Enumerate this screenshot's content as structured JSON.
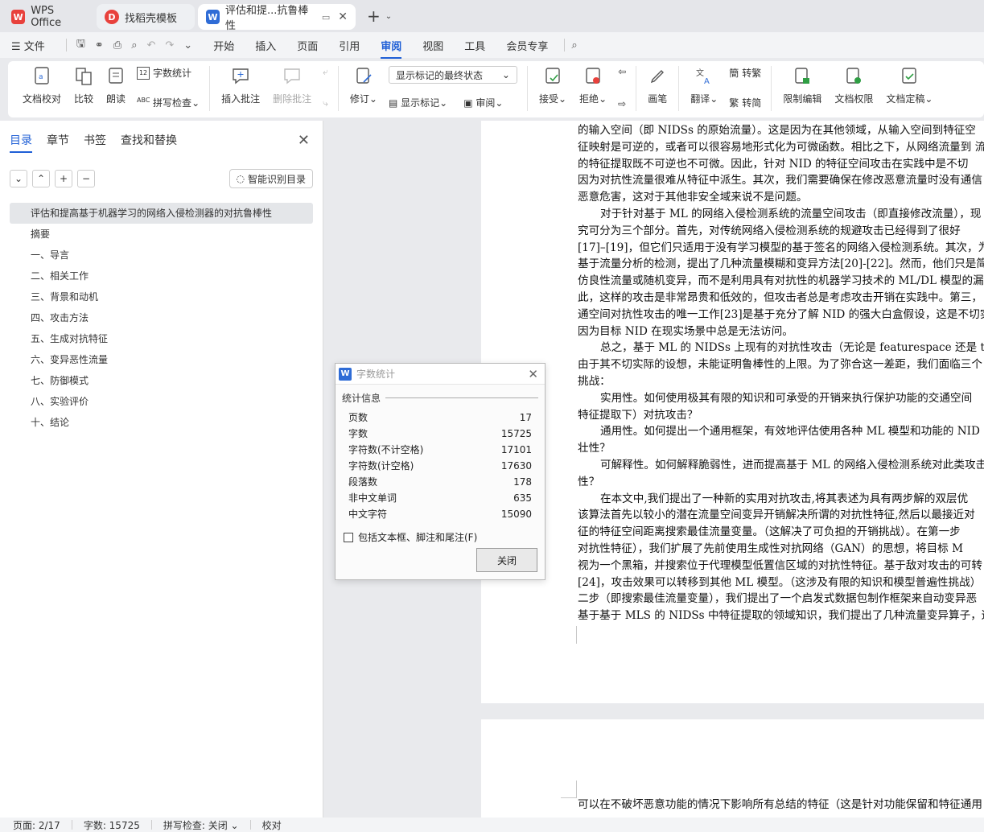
{
  "titlebar": {
    "tabs": [
      {
        "label": "WPS Office",
        "icon": "wps-logo-icon"
      },
      {
        "label": "找稻壳模板",
        "icon": "docer-icon"
      },
      {
        "label": "评估和提...抗鲁棒性",
        "icon": "word-doc-icon"
      }
    ]
  },
  "menubar": {
    "file": "文件",
    "items": [
      "开始",
      "插入",
      "页面",
      "引用",
      "审阅",
      "视图",
      "工具",
      "会员专享"
    ],
    "active": "审阅"
  },
  "ribbon": {
    "doc_check": "文档校对",
    "compare": "比较",
    "read_aloud": "朗读",
    "word_count": "字数统计",
    "spell_check": "拼写检查",
    "insert_comment": "插入批注",
    "delete_comment": "删除批注",
    "revise": "修订",
    "markup_state": "显示标记的最终状态",
    "show_markup": "显示标记",
    "review": "审阅",
    "accept": "接受",
    "reject": "拒绝",
    "pen": "画笔",
    "translate": "翻译",
    "to_traditional": "转繁",
    "to_simplified": "转简",
    "restrict_edit": "限制编辑",
    "doc_permission": "文档权限",
    "doc_finalize": "文档定稿"
  },
  "leftpanel": {
    "tabs": [
      "目录",
      "章节",
      "书签",
      "查找和替换"
    ],
    "smart_toc": "智能识别目录",
    "toc": [
      "评估和提高基于机器学习的网络入侵检测器的对抗鲁棒性",
      "摘要",
      "一、导言",
      "二、相关工作",
      "三、背景和动机",
      "四、攻击方法",
      "五、生成对抗特征",
      "六、变异恶性流量",
      "七、防御模式",
      "八、实验评价",
      "十、结论"
    ]
  },
  "document": {
    "page1_lines": [
      "的输入空间（即 NIDSs 的原始流量）。这是因为在其他领域，从输入空间到特征空",
      "征映射是可逆的，或者可以很容易地形式化为可微函数。相比之下，从网络流量到 流",
      "的特征提取既不可逆也不可微。因此，针对 NID 的特征空间攻击在实践中是不切",
      "因为对抗性流量很难从特征中派生。其次，我们需要确保在修改恶意流量时没有通信",
      "恶意危害，这对于其他非安全域来说不是问题。",
      "对于针对基于 ML 的网络入侵检测系统的流量空间攻击（即直接修改流量），现",
      "究可分为三个部分。首先，对传统网络入侵检测系统的规避攻击已经得到了很好",
      "[17]–[19]，但它们只适用于没有学习模型的基于签名的网络入侵检测系统。其次，为",
      "基于流量分析的检测，提出了几种流量模糊和变异方法[20]-[22]。然而，他们只是简",
      "仿良性流量或随机变异，而不是利用具有对抗性的机器学习技术的 ML/DL 模型的漏",
      "此，这样的攻击是非常昂贵和低效的，但攻击者总是考虑攻击开销在实践中。第三，",
      "通空间对抗性攻击的唯一工作[23]是基于充分了解 NID 的强大白盒假设，这是不切实",
      "因为目标 NID 在现实场景中总是无法访问。",
      "总之，基于 ML 的 NIDSs 上现有的对抗性攻击（无论是 featurespace 还是 traffic",
      "由于其不切实际的设想，未能证明鲁棒性的上限。为了弥合这一差距，我们面临三个",
      "挑战：",
      "实用性。如何使用极其有限的知识和可承受的开销来执行保护功能的交通空间",
      "特征提取下）对抗攻击？",
      "通用性。如何提出一个通用框架，有效地评估使用各种 ML 模型和功能的 NID",
      "壮性？",
      "可解释性。如何解释脆弱性，进而提高基于 ML 的网络入侵检测系统对此类攻击",
      "性？",
      "在本文中,我们提出了一种新的实用对抗攻击,将其表述为具有两步解的双层优",
      "该算法首先以较小的潜在流量空间变异开销解决所谓的对抗性特征,然后以最接近对",
      "征的特征空间距离搜索最佳流量变量。（这解决了可负担的开销挑战）。在第一步",
      "对抗性特征），我们扩展了先前使用生成性对抗网络（GAN）的思想，将目标 M",
      "视为一个黑箱，并搜索位于代理模型低置信区域的对抗性特征。基于敌对攻击的可转",
      "[24]，攻击效果可以转移到其他 ML 模型。（这涉及有限的知识和模型普遍性挑战）",
      "二步（即搜索最佳流量变量），我们提出了一个启发式数据包制作框架来自动变异恶",
      "基于基于 MLS 的 NIDSs 中特征提取的领域知识，我们提出了几种流量变异算子，这"
    ],
    "page2_lines": [
      "可以在不破坏恶意功能的情况下影响所有总结的特征（这是针对功能保留和特征通用"
    ]
  },
  "dialog": {
    "title": "字数统计",
    "section": "统计信息",
    "rows": [
      {
        "label": "页数",
        "value": "17"
      },
      {
        "label": "字数",
        "value": "15725"
      },
      {
        "label": "字符数(不计空格)",
        "value": "17101"
      },
      {
        "label": "字符数(计空格)",
        "value": "17630"
      },
      {
        "label": "段落数",
        "value": "178"
      },
      {
        "label": "非中文单词",
        "value": "635"
      },
      {
        "label": "中文字符",
        "value": "15090"
      }
    ],
    "checkbox_label": "包括文本框、脚注和尾注(F)",
    "close_button": "关闭"
  },
  "statusbar": {
    "page": "页面: 2/17",
    "words": "字数: 15725",
    "spell": "拼写检查: 关闭",
    "proof": "校对"
  },
  "colors": {
    "accent": "#1f5fd6",
    "wps_red": "#e8413c"
  }
}
